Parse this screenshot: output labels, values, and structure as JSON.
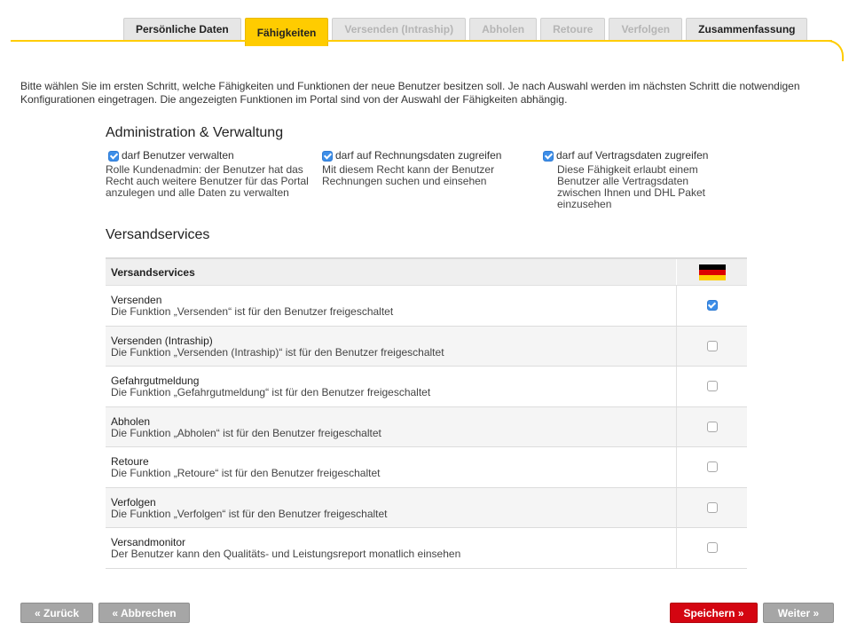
{
  "tabs": [
    {
      "label": "Persönliche Daten",
      "state": "enabled"
    },
    {
      "label": "Fähigkeiten",
      "state": "active"
    },
    {
      "label": "Versenden (Intraship)",
      "state": "disabled"
    },
    {
      "label": "Abholen",
      "state": "disabled"
    },
    {
      "label": "Retoure",
      "state": "disabled"
    },
    {
      "label": "Verfolgen",
      "state": "disabled"
    },
    {
      "label": "Zusammenfassung",
      "state": "enabled"
    }
  ],
  "intro": "Bitte wählen Sie im ersten Schritt, welche Fähigkeiten und Funktionen der neue Benutzer besitzen soll. Je nach Auswahl werden im nächsten Schritt die notwendigen Konfigurationen eingetragen. Die angezeigten Funktionen im Portal sind von der Auswahl der Fähigkeiten abhängig.",
  "admin": {
    "title": "Administration & Verwaltung",
    "permissions": [
      {
        "label": "darf Benutzer verwalten",
        "checked": true,
        "desc": "Rolle Kundenadmin: der Benutzer hat das Recht auch weitere Benutzer für das Portal anzulegen und alle Daten zu verwalten"
      },
      {
        "label": "darf auf Rechnungsdaten zugreifen",
        "checked": true,
        "desc": "Mit diesem Recht kann der Benutzer Rechnungen suchen und einsehen"
      },
      {
        "label": "darf auf Vertragsdaten zugreifen",
        "checked": true,
        "desc": "Diese Fähigkeit erlaubt einem Benutzer alle Vertragsdaten zwischen Ihnen und DHL Paket einzusehen"
      }
    ]
  },
  "services": {
    "title": "Versandservices",
    "header": "Versandservices",
    "flag_colors": [
      "#000000",
      "#dd0000",
      "#ffce00"
    ],
    "rows": [
      {
        "title": "Versenden",
        "desc": "Die Funktion „Versenden“ ist für den Benutzer freigeschaltet",
        "checked": true
      },
      {
        "title": "Versenden (Intraship)",
        "desc": "Die Funktion „Versenden (Intraship)“ ist für den Benutzer freigeschaltet",
        "checked": false
      },
      {
        "title": "Gefahrgutmeldung",
        "desc": "Die Funktion „Gefahrgutmeldung“ ist für den Benutzer freigeschaltet",
        "checked": false
      },
      {
        "title": "Abholen",
        "desc": "Die Funktion „Abholen“ ist für den Benutzer freigeschaltet",
        "checked": false
      },
      {
        "title": "Retoure",
        "desc": "Die Funktion „Retoure“ ist für den Benutzer freigeschaltet",
        "checked": false
      },
      {
        "title": "Verfolgen",
        "desc": "Die Funktion „Verfolgen“ ist für den Benutzer freigeschaltet",
        "checked": false
      },
      {
        "title": "Versandmonitor",
        "desc": "Der Benutzer kann den Qualitäts- und Leistungsreport monatlich einsehen",
        "checked": false
      }
    ]
  },
  "buttons": {
    "back": "« Zurück",
    "cancel": "« Abbrechen",
    "save": "Speichern »",
    "next": "Weiter »"
  },
  "colors": {
    "accent": "#ffcc00",
    "primary_button": "#d40511",
    "secondary_button": "#a6a6a6",
    "checkbox": "#3d8ee8"
  }
}
